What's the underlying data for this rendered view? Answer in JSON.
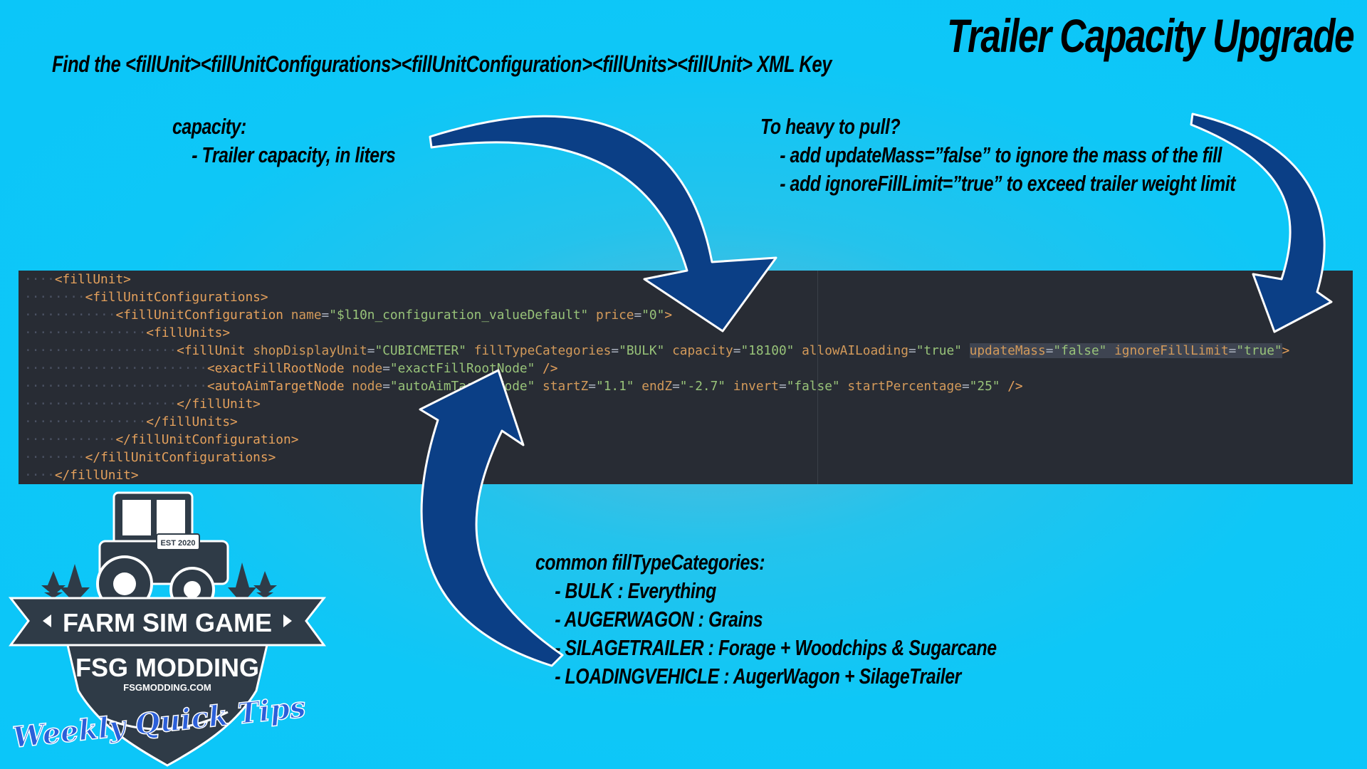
{
  "title": "Trailer Capacity Upgrade",
  "intro": "Find the <fillUnit><fillUnitConfigurations><fillUnitConfiguration><fillUnits><fillUnit> XML Key",
  "capacity_note": {
    "heading": "capacity:",
    "line": "- Trailer capacity, in liters"
  },
  "heavy_note": {
    "heading": "To heavy to pull?",
    "line1": "- add updateMass=”false” to ignore the mass of the fill",
    "line2": "- add ignoreFillLimit=”true” to exceed trailer weight limit"
  },
  "categories_note": {
    "heading": "common fillTypeCategories:",
    "items": [
      "- BULK : Everything",
      "- AUGERWAGON : Grains",
      "- SILAGETRAILER : Forage + Woodchips & Sugarcane",
      "- LOADINGVEHICLE : AugerWagon + SilageTrailer"
    ]
  },
  "code": {
    "l1": {
      "indent": "····",
      "tag": "<fillUnit>"
    },
    "l2": {
      "indent": "········",
      "tag": "<fillUnitConfigurations>"
    },
    "l3": {
      "indent": "············",
      "tag": "<fillUnitConfiguration",
      "a1": "name",
      "v1": "\"$l10n_configuration_valueDefault\"",
      "a2": "price",
      "v2": "\"0\"",
      "end": ">"
    },
    "l4": {
      "indent": "················",
      "tag": "<fillUnits>"
    },
    "l5": {
      "indent": "····················",
      "tag": "<fillUnit",
      "a1": "shopDisplayUnit",
      "v1": "\"CUBICMETER\"",
      "a2": "fillTypeCategories",
      "v2": "\"BULK\"",
      "a3": "capacity",
      "v3": "\"18100\"",
      "a4": "allowAILoading",
      "v4": "\"true\"",
      "a5": "updateMass",
      "v5": "\"false\"",
      "a6": "ignoreFillLimit",
      "v6": "\"true\"",
      "end": ">"
    },
    "l6": {
      "indent": "························",
      "tag": "<exactFillRootNode",
      "a1": "node",
      "v1": "\"exactFillRootNode\"",
      "end": "/>"
    },
    "l7": {
      "indent": "························",
      "tag": "<autoAimTargetNode",
      "a1": "node",
      "v1": "\"autoAimTargetNode\"",
      "a2": "startZ",
      "v2": "\"1.1\"",
      "a3": "endZ",
      "v3": "\"-2.7\"",
      "a4": "invert",
      "v4": "\"false\"",
      "a5": "startPercentage",
      "v5": "\"25\"",
      "end": "/>"
    },
    "l8": {
      "indent": "····················",
      "tag": "</fillUnit>"
    },
    "l9": {
      "indent": "················",
      "tag": "</fillUnits>"
    },
    "l10": {
      "indent": "············",
      "tag": "</fillUnitConfiguration>"
    },
    "l11": {
      "indent": "········",
      "tag": "</fillUnitConfigurations>"
    },
    "l12": {
      "indent": "····",
      "tag": "</fillUnit>"
    }
  },
  "logo": {
    "badge": "EST 2020",
    "banner": "FARM SIM GAME",
    "name": "FSG MODDING",
    "url": "FSGMODDING.COM",
    "tagline": "Weekly Quick Tips"
  },
  "colors": {
    "background": "#0bc6f9",
    "arrow": "#0b3f86",
    "editor_bg": "#282c34",
    "logo_dark": "#2f3b47"
  }
}
